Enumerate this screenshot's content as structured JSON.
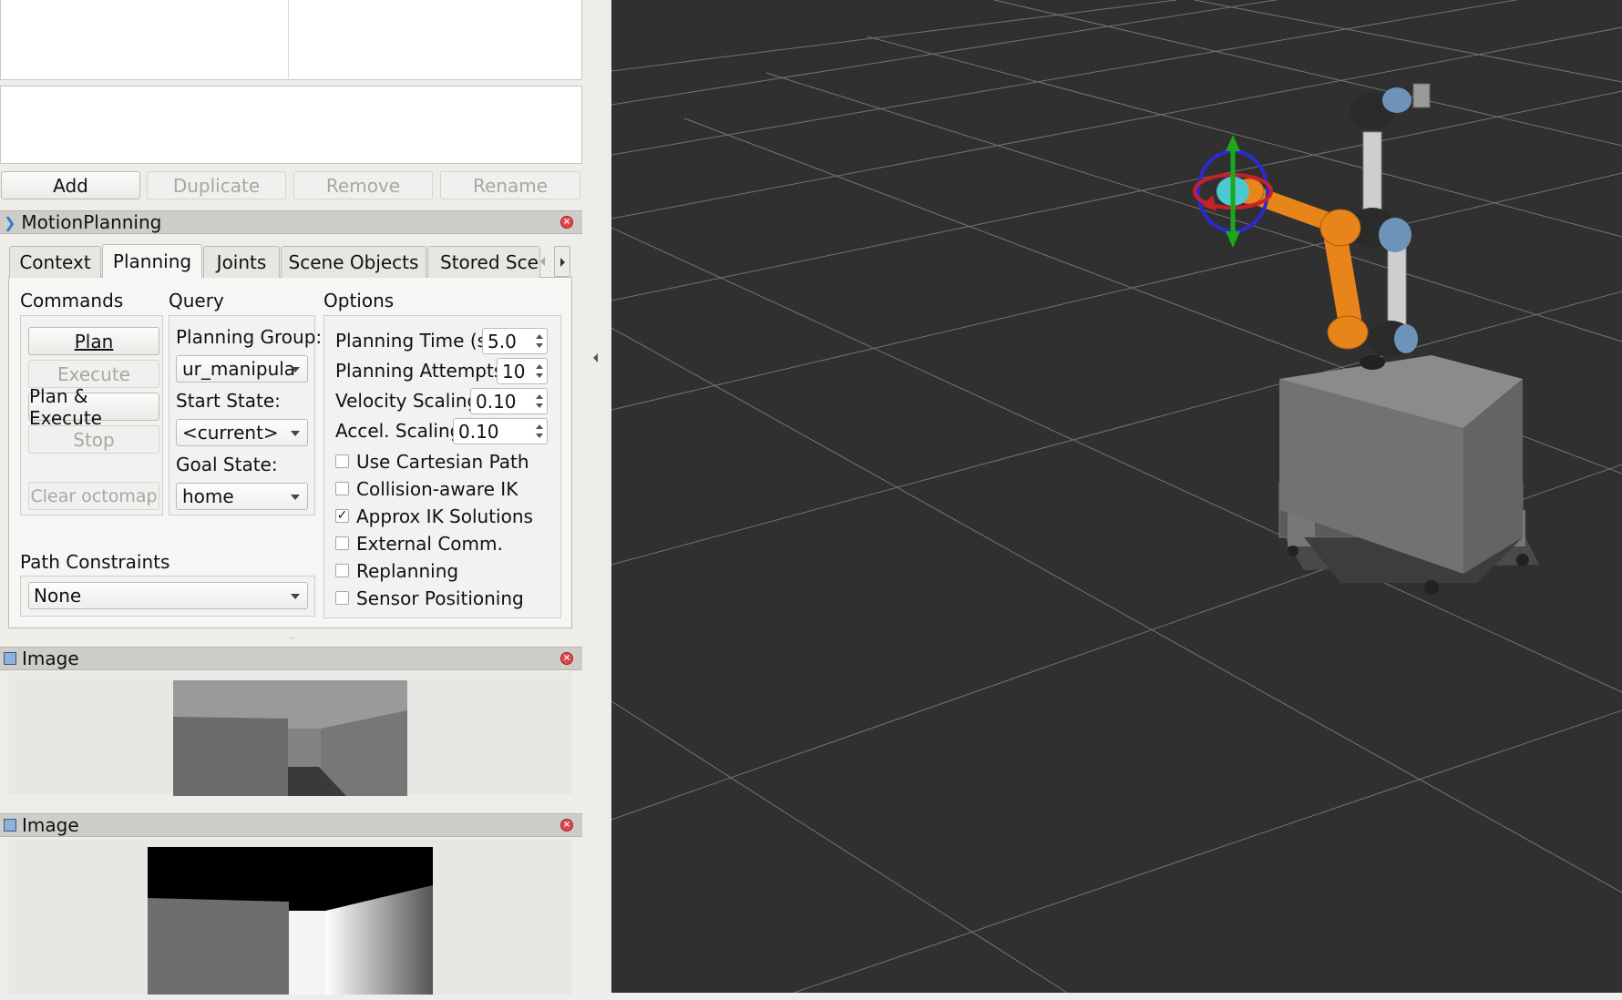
{
  "top_buttons": {
    "add": "Add",
    "duplicate": "Duplicate",
    "remove": "Remove",
    "rename": "Rename"
  },
  "motion_planning": {
    "title": "MotionPlanning",
    "tabs": [
      "Context",
      "Planning",
      "Joints",
      "Scene Objects",
      "Stored Scen"
    ],
    "active_tab": "Planning",
    "commands": {
      "heading": "Commands",
      "plan": "Plan",
      "execute": "Execute",
      "plan_execute": "Plan & Execute",
      "stop": "Stop",
      "clear_octomap": "Clear octomap"
    },
    "query": {
      "heading": "Query",
      "planning_group_label": "Planning Group:",
      "planning_group_value": "ur_manipula",
      "start_state_label": "Start State:",
      "start_state_value": "<current>",
      "goal_state_label": "Goal State:",
      "goal_state_value": "home"
    },
    "options": {
      "heading": "Options",
      "planning_time_label": "Planning Time (s):",
      "planning_time_value": "5.0",
      "planning_attempts_label": "Planning Attempts:",
      "planning_attempts_value": "10",
      "velocity_scaling_label": "Velocity Scaling:",
      "velocity_scaling_value": "0.10",
      "accel_scaling_label": "Accel. Scaling:",
      "accel_scaling_value": "0.10",
      "checkboxes": [
        {
          "label": "Use Cartesian Path",
          "checked": false
        },
        {
          "label": "Collision-aware IK",
          "checked": false
        },
        {
          "label": "Approx IK Solutions",
          "checked": true
        },
        {
          "label": "External Comm.",
          "checked": false
        },
        {
          "label": "Replanning",
          "checked": false
        },
        {
          "label": "Sensor Positioning",
          "checked": false
        }
      ]
    },
    "path_constraints": {
      "heading": "Path Constraints",
      "value": "None"
    }
  },
  "image_panels": [
    {
      "title": "Image"
    },
    {
      "title": "Image"
    }
  ],
  "colors": {
    "viewport_bg": "#303030",
    "robot_orange": "#e8851a",
    "panel_bg": "#efedea"
  }
}
